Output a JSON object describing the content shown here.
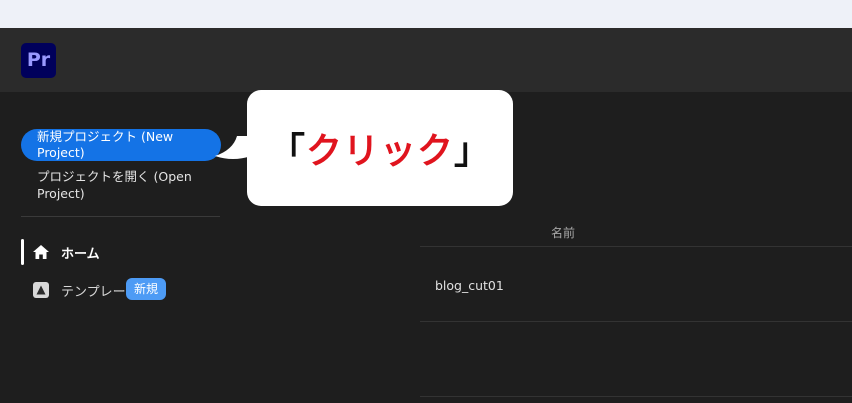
{
  "app": {
    "logo_text": "Pr",
    "brand_color": "#00005b",
    "logo_text_color": "#9999ff"
  },
  "sidebar": {
    "new_project_label": "新規プロジェクト (New Project)",
    "open_project_label": "プロジェクトを開く (Open Project)",
    "nav": [
      {
        "label": "ホーム",
        "icon": "home-icon",
        "active": true
      },
      {
        "label": "テンプレート",
        "icon": "templates-icon",
        "badge": "新規"
      }
    ],
    "accent_color": "#1473e6"
  },
  "main": {
    "column_header": "名前",
    "rows": [
      {
        "name": "blog_cut01"
      }
    ]
  },
  "callout": {
    "open_bracket": "「",
    "text": "クリック",
    "close_bracket": "」",
    "text_color": "#e0141e"
  }
}
